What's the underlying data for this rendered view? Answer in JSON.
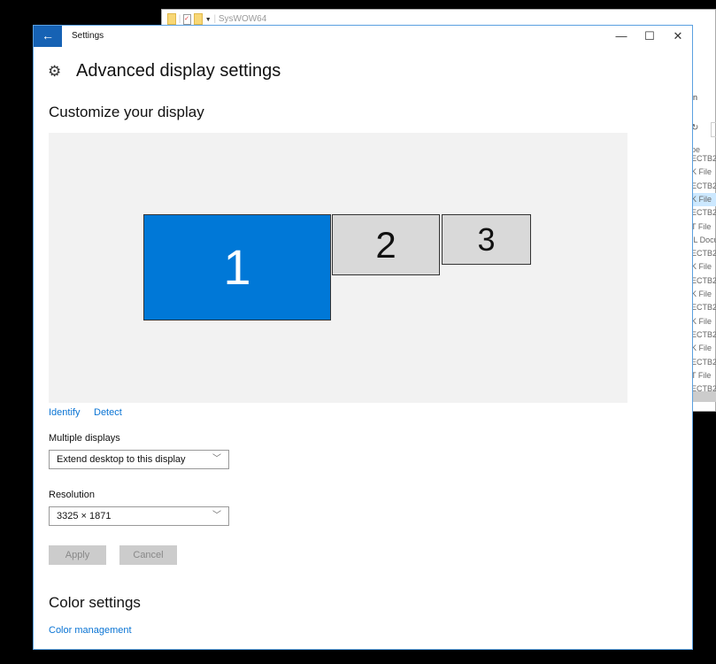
{
  "explorer": {
    "path": "SysWOW64",
    "ribbon_fragment": "n",
    "column_header": "pe",
    "rows": [
      {
        "t": "ECTB2"
      },
      {
        "t": "K File"
      },
      {
        "t": "ECTB2"
      },
      {
        "t": "K File",
        "selected": true
      },
      {
        "t": "ECTB2"
      },
      {
        "t": "T File"
      },
      {
        "t": "IL Docu"
      },
      {
        "t": "ECTB2"
      },
      {
        "t": "K File"
      },
      {
        "t": "ECTB2"
      },
      {
        "t": "K File"
      },
      {
        "t": "ECTB2"
      },
      {
        "t": "K File"
      },
      {
        "t": "ECTB2"
      },
      {
        "t": "K File"
      },
      {
        "t": "ECTB2"
      },
      {
        "t": "T File"
      },
      {
        "t": "ECTB2"
      }
    ]
  },
  "window": {
    "title": "Settings",
    "back_icon": "←",
    "minimize": "—",
    "maximize": "☐",
    "close": "✕"
  },
  "page": {
    "title": "Advanced display settings",
    "section": "Customize your display"
  },
  "displays": [
    {
      "label": "1",
      "selected": true
    },
    {
      "label": "2"
    },
    {
      "label": "3"
    }
  ],
  "colors": {
    "accent": "#0078d7",
    "monitor": "#d9d9d9"
  },
  "links": {
    "identify": "Identify",
    "detect": "Detect"
  },
  "multiple_displays": {
    "label": "Multiple displays",
    "value": "Extend desktop to this display"
  },
  "resolution": {
    "label": "Resolution",
    "value": "3325 × 1871"
  },
  "buttons": {
    "apply": "Apply",
    "cancel": "Cancel"
  },
  "color_settings": {
    "title": "Color settings",
    "link": "Color management"
  }
}
